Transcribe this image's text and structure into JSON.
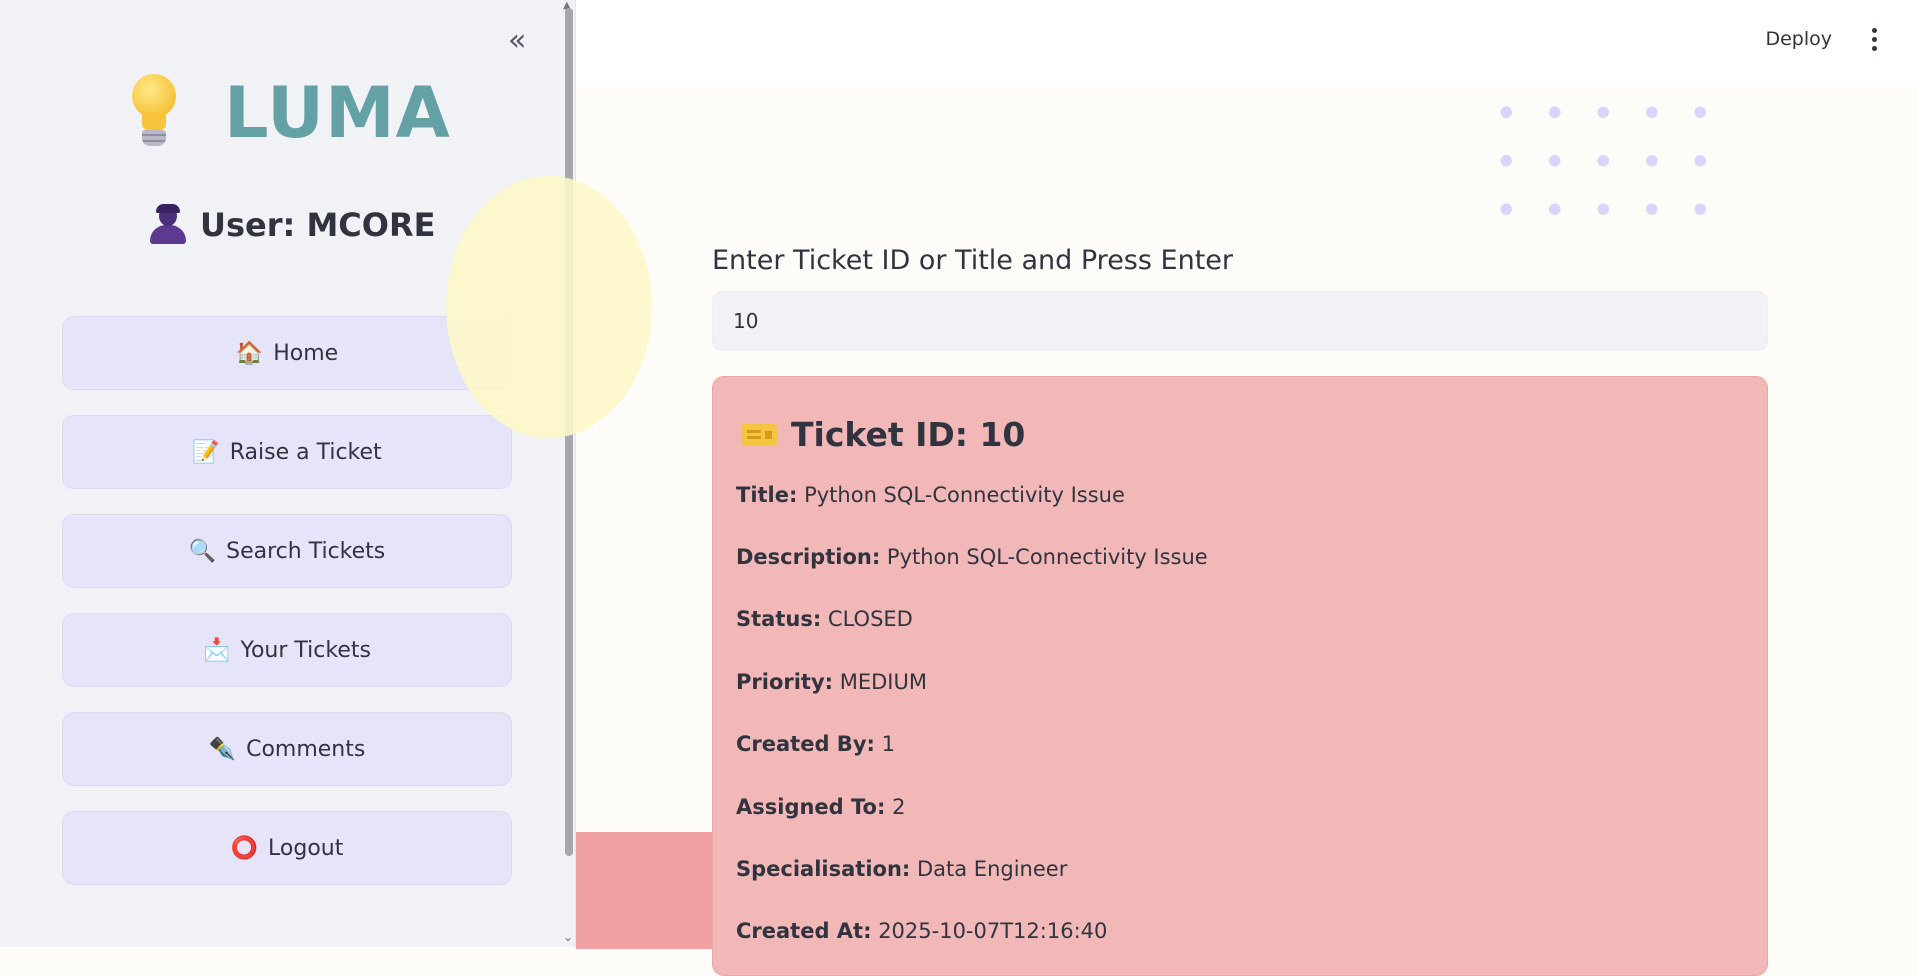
{
  "sidebar": {
    "collapse_label": "«",
    "brand": {
      "title": "LUMA",
      "icon": "lightbulb-icon"
    },
    "user": {
      "icon": "user-silhouette-icon",
      "text": "User: MCORE"
    },
    "nav": [
      {
        "icon": "🏠",
        "label": "Home"
      },
      {
        "icon": "📝",
        "label": "Raise a Ticket"
      },
      {
        "icon": "🔍",
        "label": "Search Tickets"
      },
      {
        "icon": "📩",
        "label": "Your Tickets"
      },
      {
        "icon": "✒️",
        "label": "Comments"
      },
      {
        "icon": "⭕",
        "label": "Logout"
      }
    ]
  },
  "header": {
    "deploy_label": "Deploy",
    "menu_icon": "kebab-menu-icon"
  },
  "search": {
    "label": "Enter Ticket ID or Title and Press Enter",
    "value": "10"
  },
  "ticket": {
    "title": "Ticket ID: 10",
    "icon": "ticket-icon",
    "fields": [
      {
        "label": "Title:",
        "value": "Python SQL-Connectivity Issue"
      },
      {
        "label": "Description:",
        "value": "Python SQL-Connectivity Issue"
      },
      {
        "label": "Status:",
        "value": "CLOSED"
      },
      {
        "label": "Priority:",
        "value": "MEDIUM"
      },
      {
        "label": "Created By:",
        "value": "1"
      },
      {
        "label": "Assigned To:",
        "value": "2"
      },
      {
        "label": "Specialisation:",
        "value": "Data Engineer"
      },
      {
        "label": "Created At:",
        "value": "2025-10-07T12:16:40"
      }
    ]
  },
  "colors": {
    "brand": "#64a1a5",
    "sidebar_bg": "#f0f2f6",
    "nav_button_bg": "#e6e4f8",
    "card_bg": "#f2b8b8"
  }
}
